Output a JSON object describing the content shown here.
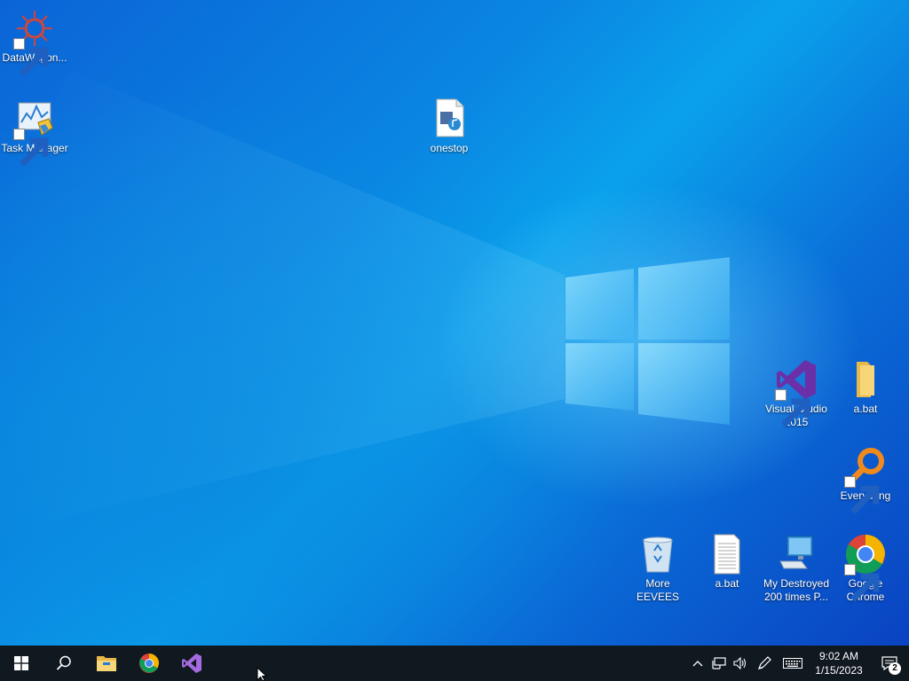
{
  "desktop": {
    "icons": [
      {
        "id": "datawagon",
        "label": "DataWagon...",
        "icon": "datawagon-gear-icon",
        "shortcut": true
      },
      {
        "id": "task-manager",
        "label": "Task Manager",
        "icon": "task-manager-icon",
        "shortcut": true
      },
      {
        "id": "onestop",
        "label": "onestop",
        "icon": "media-file-icon",
        "shortcut": false
      },
      {
        "id": "visual-studio",
        "label": "Visual Studio 2015",
        "icon": "visual-studio-icon",
        "shortcut": true
      },
      {
        "id": "abat-folder",
        "label": "a.bat",
        "icon": "folder-icon",
        "shortcut": false
      },
      {
        "id": "everything",
        "label": "Everything",
        "icon": "everything-search-icon",
        "shortcut": true
      },
      {
        "id": "more-eevees",
        "label": "More EEVEES",
        "icon": "recycle-bin-icon",
        "shortcut": false
      },
      {
        "id": "abat-file",
        "label": "a.bat",
        "icon": "text-file-icon",
        "shortcut": false
      },
      {
        "id": "my-destroyed",
        "label": "My Destroyed 200 times P...",
        "icon": "computer-icon",
        "shortcut": false
      },
      {
        "id": "google-chrome",
        "label": "Google Chrome",
        "icon": "chrome-icon",
        "shortcut": true
      }
    ]
  },
  "taskbar": {
    "pinned": [
      "start-icon",
      "search-icon",
      "file-explorer-icon",
      "chrome-icon",
      "visual-studio-icon"
    ],
    "clock": {
      "time": "9:02 AM",
      "date": "1/15/2023"
    },
    "notification_count": "2"
  },
  "colors": {
    "taskbar": "#101820",
    "accent": "#0a86e2"
  }
}
